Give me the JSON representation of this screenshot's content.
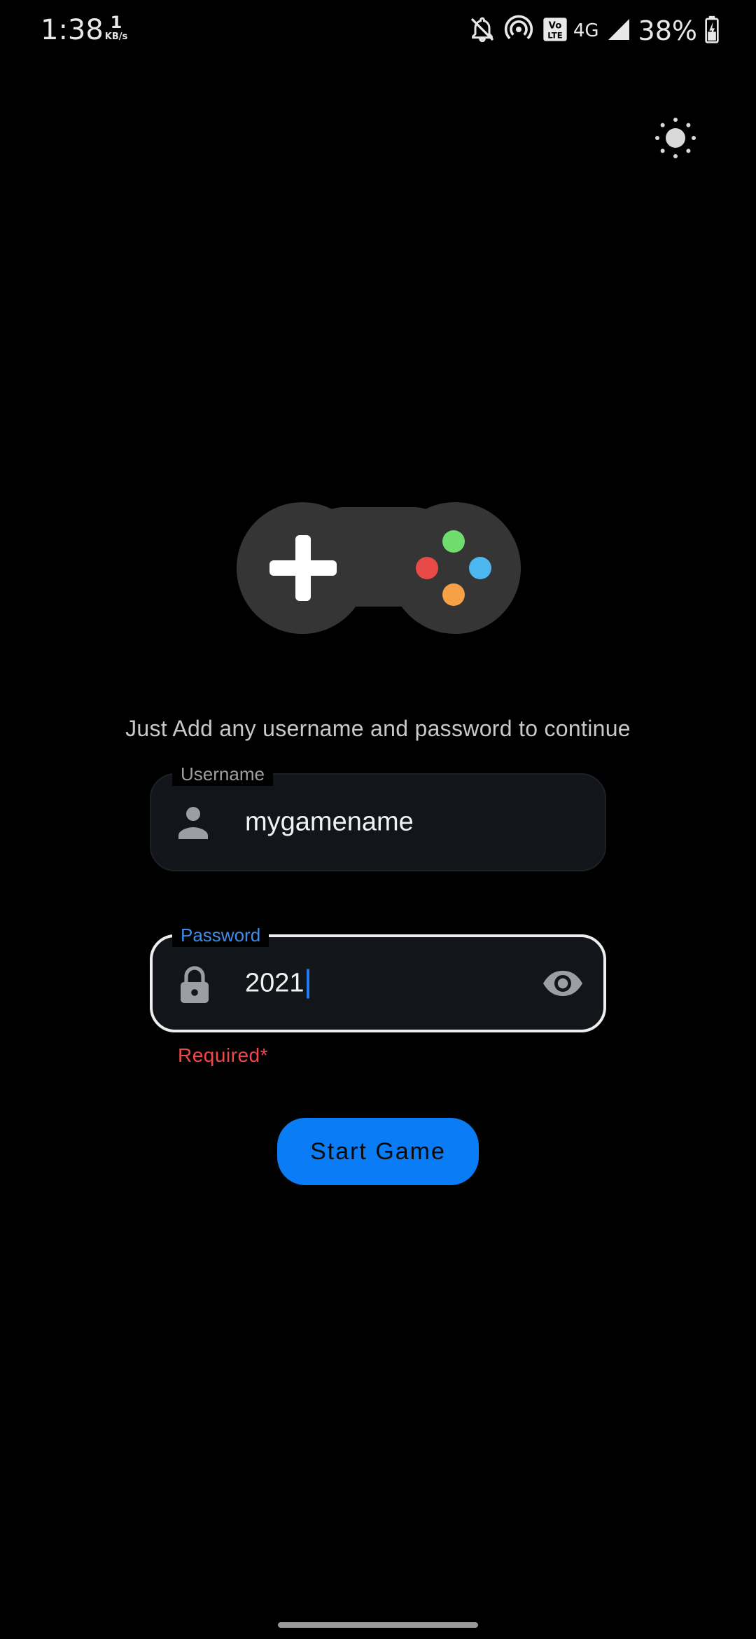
{
  "status_bar": {
    "time": "1:38",
    "speed_value": "1",
    "speed_unit": "KB/s",
    "network": "4G",
    "battery": "38%",
    "icons": [
      "bell-off-icon",
      "hotspot-icon",
      "volte-icon",
      "signal-icon",
      "battery-charging-icon"
    ]
  },
  "theme_toggle": {
    "icon": "sun-icon"
  },
  "logo": {
    "icon": "gamepad-icon",
    "colors": {
      "body": "#353535",
      "dpad": "#ffffff",
      "button_top": "#6fdc6e",
      "button_left": "#e84b47",
      "button_right": "#4db8f0",
      "button_bottom": "#f7a146"
    }
  },
  "hint": "Just Add any username and password to continue",
  "username": {
    "label": "Username",
    "value": "mygamename",
    "icon": "person-icon"
  },
  "password": {
    "label": "Password",
    "value": "2021",
    "icon": "lock-icon",
    "toggle_icon": "eye-icon",
    "error": "Required*"
  },
  "start_button": {
    "label": "Start Game"
  },
  "colors": {
    "background": "#000000",
    "accent": "#0a7cf6",
    "error": "#f0484a",
    "field_bg": "#12151a"
  }
}
